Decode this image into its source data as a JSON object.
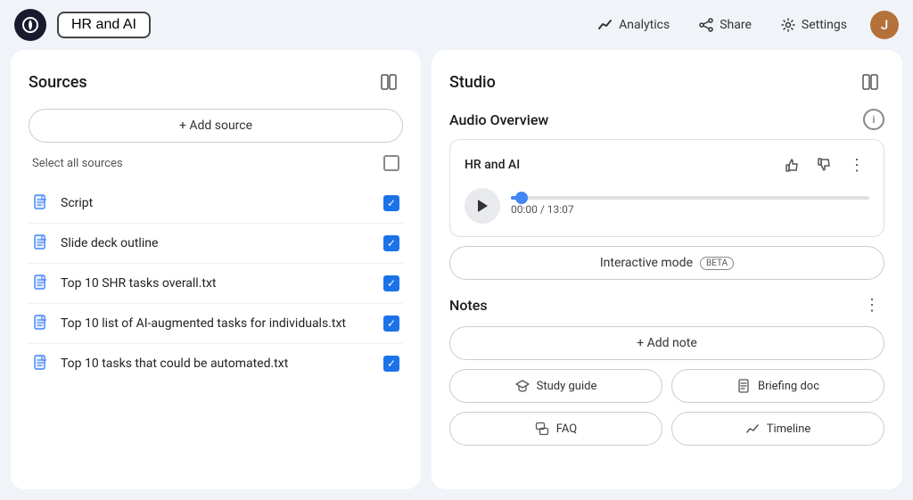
{
  "header": {
    "logo_letter": "✦",
    "notebook_title": "HR and AI",
    "analytics_label": "Analytics",
    "share_label": "Share",
    "settings_label": "Settings",
    "avatar_letter": "J"
  },
  "sources_panel": {
    "title": "Sources",
    "add_source_label": "+ Add source",
    "select_all_label": "Select all sources",
    "items": [
      {
        "name": "Script",
        "checked": true
      },
      {
        "name": "Slide deck outline",
        "checked": true
      },
      {
        "name": "Top 10 SHR tasks overall.txt",
        "checked": true
      },
      {
        "name": "Top 10 list of AI-augmented tasks for individuals.txt",
        "checked": true
      },
      {
        "name": "Top 10 tasks that could be automated.txt",
        "checked": true
      }
    ]
  },
  "studio_panel": {
    "title": "Studio",
    "audio_overview": {
      "section_title": "Audio Overview",
      "track_title": "HR and AI",
      "time_current": "00:00",
      "time_total": "13:07",
      "time_display": "00:00 / 13:07",
      "progress_percent": 3,
      "interactive_mode_label": "Interactive mode",
      "beta_label": "BETA"
    },
    "notes": {
      "section_title": "Notes",
      "add_note_label": "+ Add note",
      "actions": [
        {
          "id": "study-guide",
          "label": "Study guide",
          "icon": "graduation"
        },
        {
          "id": "briefing-doc",
          "label": "Briefing doc",
          "icon": "doc"
        },
        {
          "id": "faq",
          "label": "FAQ",
          "icon": "faq"
        },
        {
          "id": "timeline",
          "label": "Timeline",
          "icon": "timeline"
        }
      ]
    }
  }
}
